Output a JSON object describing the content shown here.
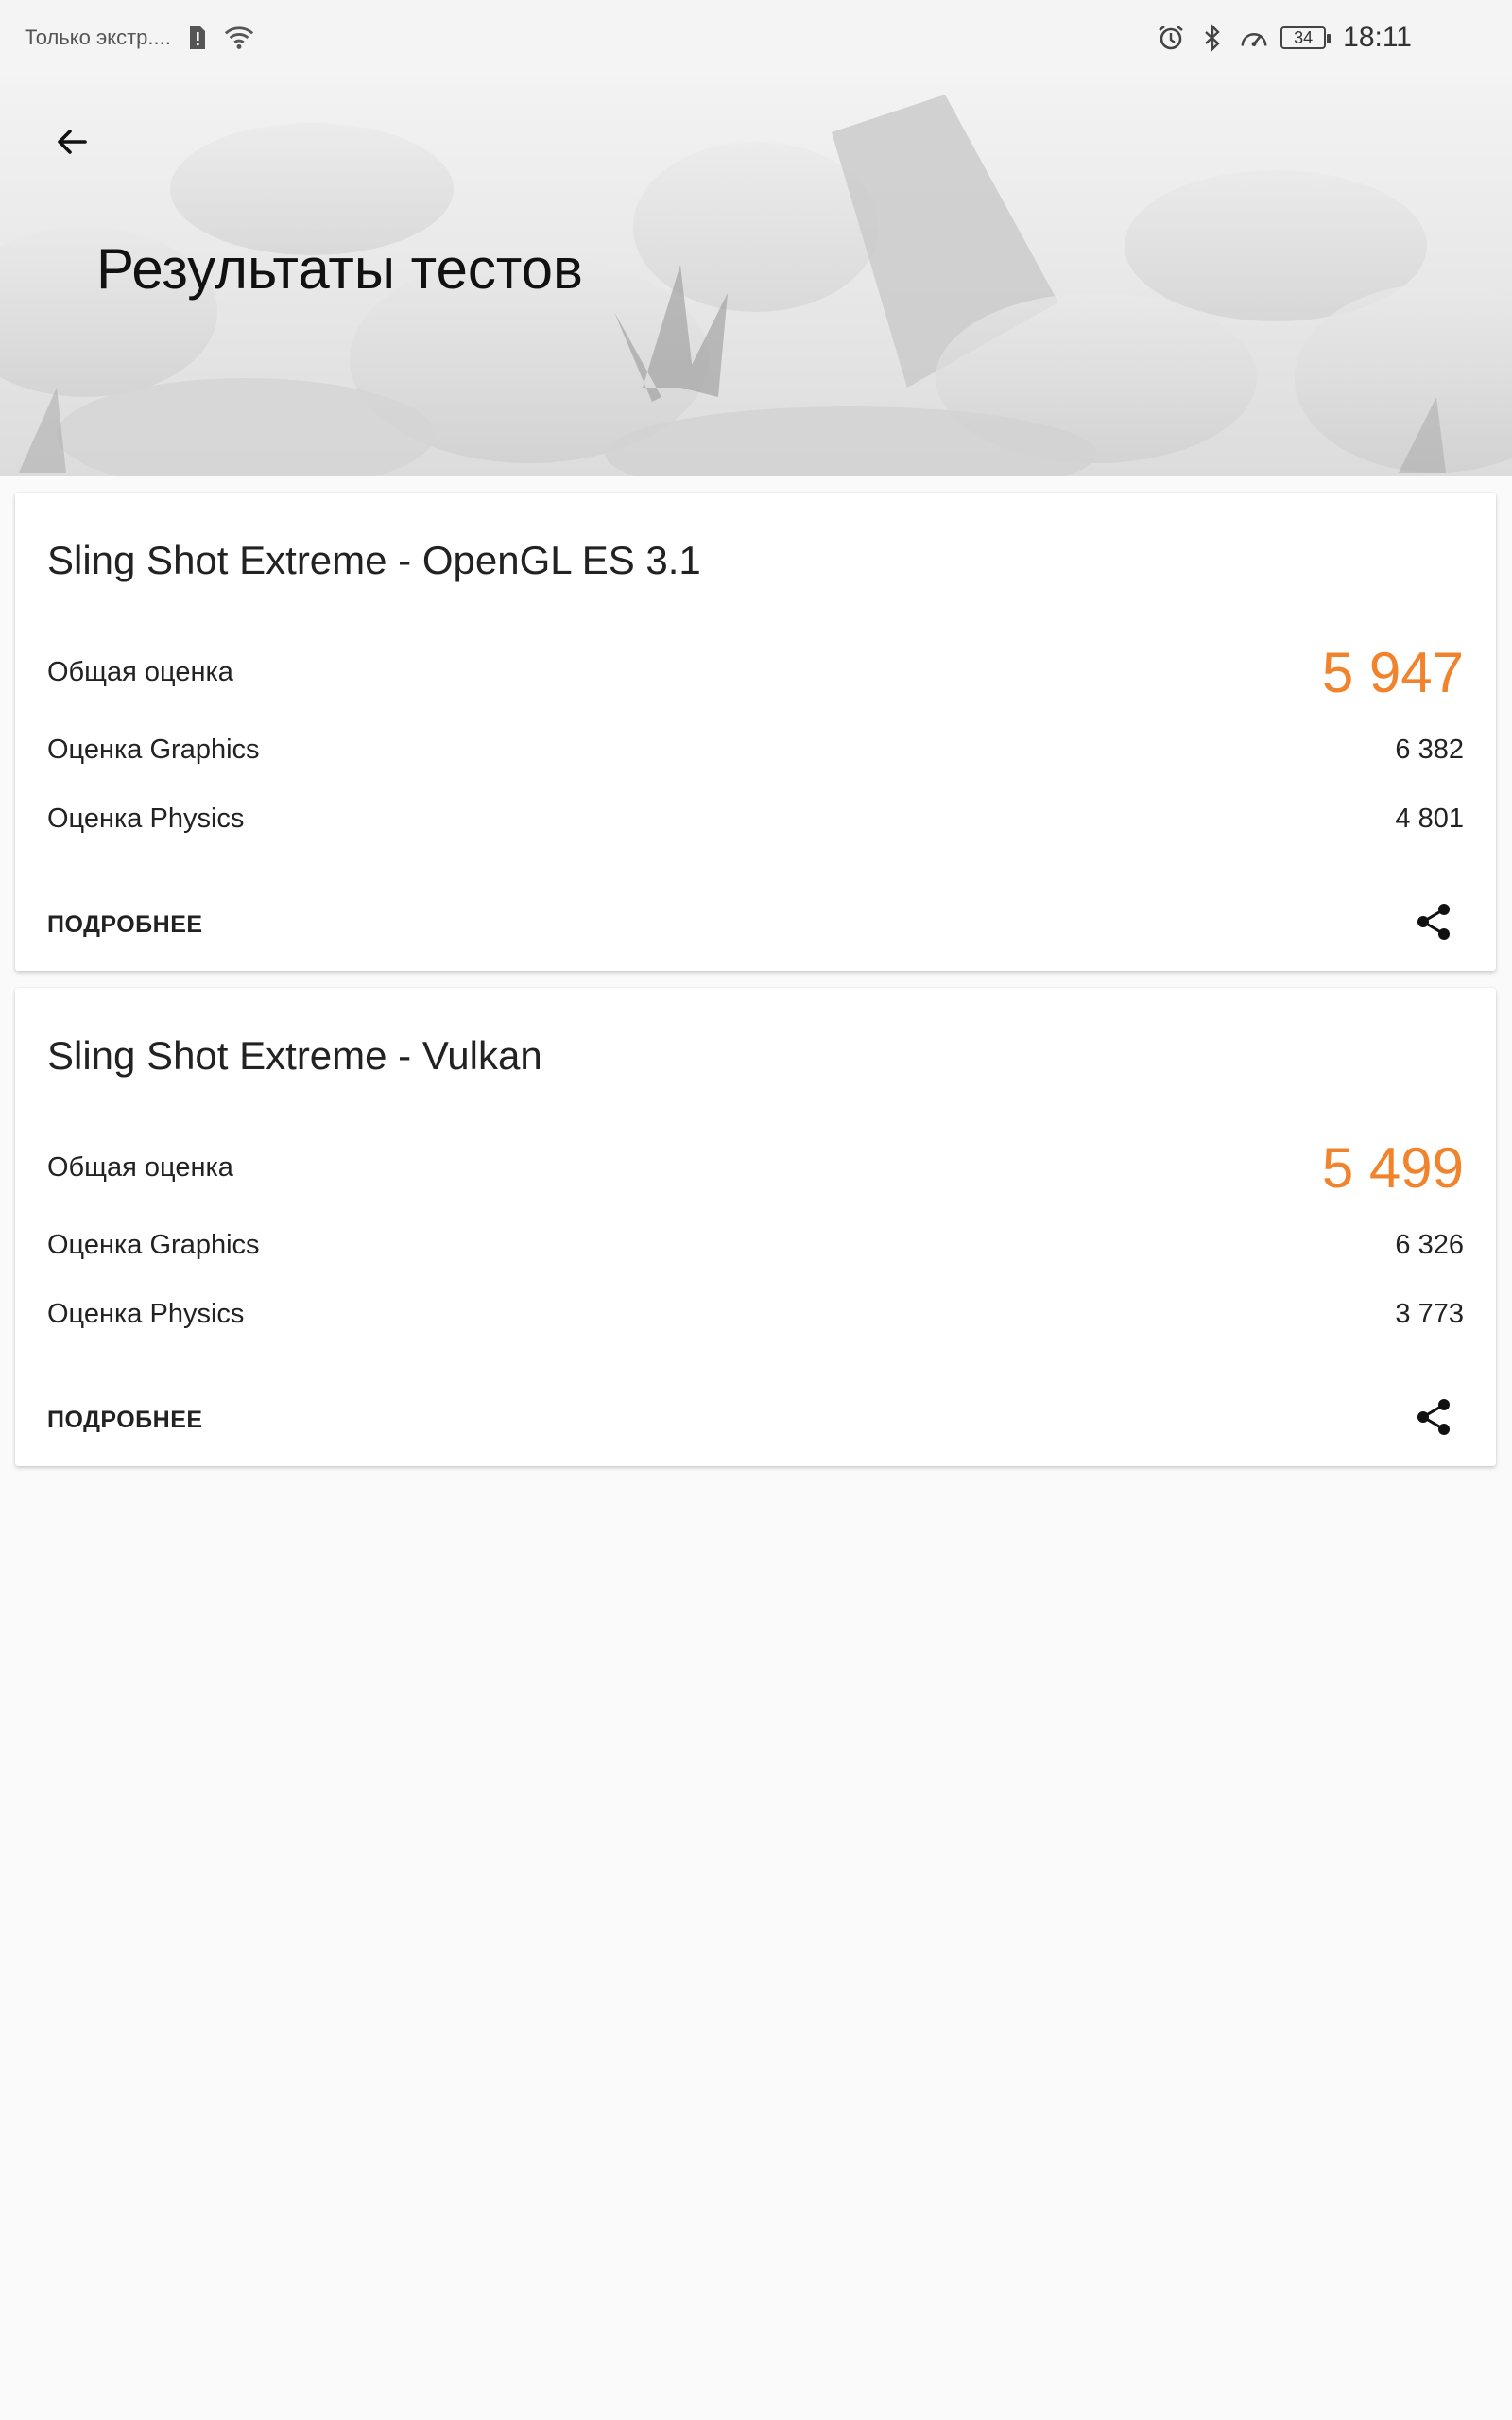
{
  "status_bar": {
    "carrier_text": "Только экстр....",
    "time": "18:11",
    "battery_level": "34",
    "icons": [
      "sim-alert-icon",
      "wifi-icon",
      "alarm-icon",
      "bluetooth-icon",
      "speedometer-icon",
      "battery-icon"
    ]
  },
  "header": {
    "title": "Результаты тестов",
    "back_icon": "arrow-left-icon"
  },
  "accent_color": "#f0832c",
  "results": [
    {
      "title": "Sling Shot Extreme - OpenGL ES 3.1",
      "overall_label": "Общая оценка",
      "overall_value": "5 947",
      "graphics_label": "Оценка Graphics",
      "graphics_value": "6 382",
      "physics_label": "Оценка Physics",
      "physics_value": "4 801",
      "details_label": "ПОДРОБНЕЕ",
      "share_icon": "share-icon"
    },
    {
      "title": "Sling Shot Extreme - Vulkan",
      "overall_label": "Общая оценка",
      "overall_value": "5 499",
      "graphics_label": "Оценка Graphics",
      "graphics_value": "6 326",
      "physics_label": "Оценка Physics",
      "physics_value": "3 773",
      "details_label": "ПОДРОБНЕЕ",
      "share_icon": "share-icon"
    }
  ]
}
